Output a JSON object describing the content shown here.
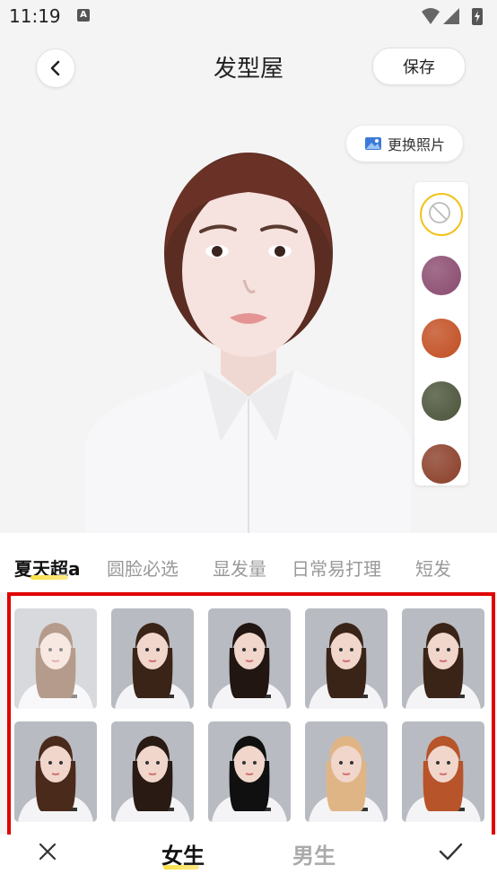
{
  "status_bar": {
    "time": "11:19",
    "notif": "A"
  },
  "header": {
    "title": "发型屋",
    "save_label": "保存"
  },
  "photo": {
    "change_photo_label": "更换照片"
  },
  "colors": {
    "swatches": [
      "#8a4a6e",
      "#c24e22",
      "#4a5238",
      "#8a3e28"
    ]
  },
  "tabs": [
    {
      "label": "夏天超a",
      "active": true
    },
    {
      "label": "圆脸必选"
    },
    {
      "label": "显发量"
    },
    {
      "label": "日常易打理"
    },
    {
      "label": "短发"
    }
  ],
  "styles_grid": {
    "row1": [
      "long-wavy-brown",
      "long-dark-layered",
      "double-braids",
      "half-up-bun",
      "straight-bangs"
    ],
    "row2": [
      "straight-long-dark",
      "high-ponytail",
      "black-bob-bangs",
      "blonde-bob",
      "double-buns-red"
    ],
    "hair_colors": [
      "#7a4a30",
      "#3a2418",
      "#221612",
      "#3a2418",
      "#3a2418",
      "#4a2a1a",
      "#2a1a14",
      "#101010",
      "#e0b585",
      "#b8542a"
    ]
  },
  "bottom": {
    "female_label": "女生",
    "male_label": "男生"
  },
  "accent": "#f8e040"
}
